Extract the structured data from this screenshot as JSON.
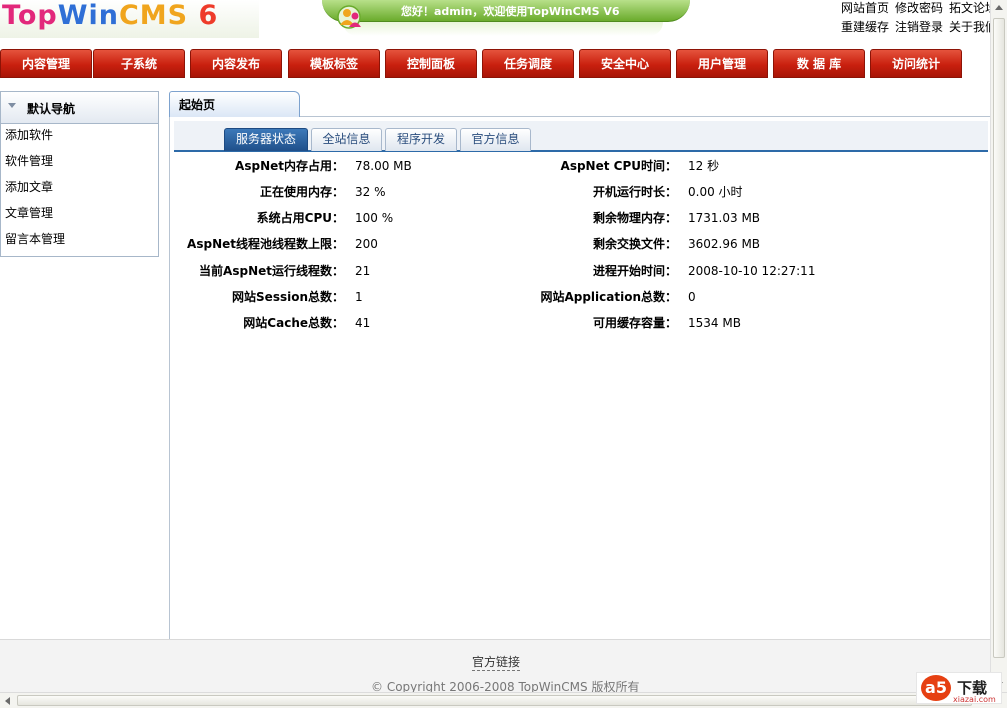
{
  "header": {
    "logo_text": {
      "part1": "Top",
      "part2": "Win",
      "part3": "CMS",
      "part4": " 6"
    },
    "welcome": "您好！admin，欢迎使用TopWinCMS V6",
    "links_row1": [
      "网站首页",
      "修改密码",
      "拓文论坛"
    ],
    "links_row2": [
      "重建缓存",
      "注销登录",
      "关于我们"
    ]
  },
  "nav": {
    "items": [
      "内容管理",
      "子系统",
      "内容发布",
      "模板标签",
      "控制面板",
      "任务调度",
      "安全中心",
      "用户管理",
      "数 据 库",
      "访问统计"
    ]
  },
  "sidebar": {
    "title": "默认导航",
    "items": [
      "添加软件",
      "软件管理",
      "添加文章",
      "文章管理",
      "留言本管理"
    ]
  },
  "content": {
    "start_tab": "起始页",
    "sub_tabs": [
      "服务器状态",
      "全站信息",
      "程序开发",
      "官方信息"
    ],
    "active_sub_tab": "服务器状态",
    "left_rows": [
      {
        "label": "AspNet内存占用：",
        "value": "78.00 MB"
      },
      {
        "label": "正在使用内存：",
        "value": "32 %"
      },
      {
        "label": "系统占用CPU：",
        "value": "100 %"
      },
      {
        "label": "AspNet线程池线程数上限：",
        "value": "200"
      },
      {
        "label": "当前AspNet运行线程数：",
        "value": "21"
      },
      {
        "label": "网站Session总数：",
        "value": "1"
      },
      {
        "label": "网站Cache总数：",
        "value": "41"
      }
    ],
    "right_rows": [
      {
        "label": "AspNet CPU时间：",
        "value": "12 秒"
      },
      {
        "label": "开机运行时长：",
        "value": "0.00 小时"
      },
      {
        "label": "剩余物理内存：",
        "value": "1731.03 MB"
      },
      {
        "label": "剩余交换文件：",
        "value": "3602.96 MB"
      },
      {
        "label": "进程开始时间：",
        "value": "2008-10-10 12:27:11"
      },
      {
        "label": "网站Application总数：",
        "value": "0"
      },
      {
        "label": "可用缓存容量：",
        "value": "1534 MB"
      }
    ]
  },
  "footer": {
    "link": "官方链接",
    "copyright": "© Copyright 2006-2008 TopWinCMS 版权所有"
  },
  "watermark": {
    "mark": "a5",
    "text": "下载",
    "sub": "xiazai.com"
  },
  "colors": {
    "nav_red": "#c9200f",
    "tab_blue": "#2d6aa8",
    "welcome_green": "#6aab2c"
  }
}
